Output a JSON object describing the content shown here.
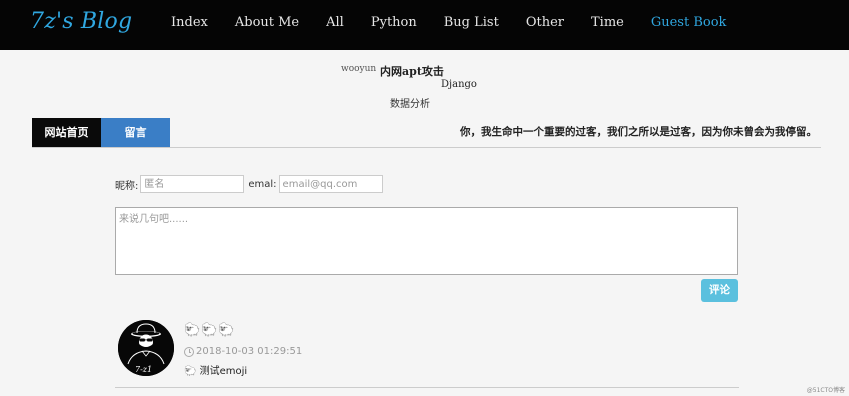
{
  "header": {
    "logo": "7z's Blog",
    "nav": [
      {
        "label": "Index",
        "active": false
      },
      {
        "label": "About Me",
        "active": false
      },
      {
        "label": "All",
        "active": false
      },
      {
        "label": "Python",
        "active": false
      },
      {
        "label": "Bug List",
        "active": false
      },
      {
        "label": "Other",
        "active": false
      },
      {
        "label": "Time",
        "active": false
      },
      {
        "label": "Guest Book",
        "active": true
      }
    ],
    "colors": {
      "background": "#050505",
      "accent": "#30a7e0"
    }
  },
  "tags": {
    "wooyun": "wooyun",
    "apt": "内网apt攻击",
    "django": "Django",
    "data": "数据分析"
  },
  "tabs": {
    "home": "网站首页",
    "message": "留言",
    "motto": "你，我生命中一个重要的过客，我们之所以是过客，因为你未曾会为我停留。",
    "colors": {
      "home_bg": "#0a0a0a",
      "message_bg": "#3a7ec6"
    }
  },
  "form": {
    "nickname_label": "昵称:",
    "nickname_placeholder": "匿名",
    "email_label": "emal:",
    "email_placeholder": "email@qq.com",
    "comment_placeholder": "来说几句吧......",
    "submit_label": "评论",
    "submit_color": "#5bc0de"
  },
  "comment": {
    "avatar_text": "7-z1",
    "emojis": "🐑🐑🐑",
    "timestamp": "2018-10-03 01:29:51",
    "text_icon": "🐑",
    "text": "测试emoji"
  },
  "watermark": "@51CTO博客"
}
